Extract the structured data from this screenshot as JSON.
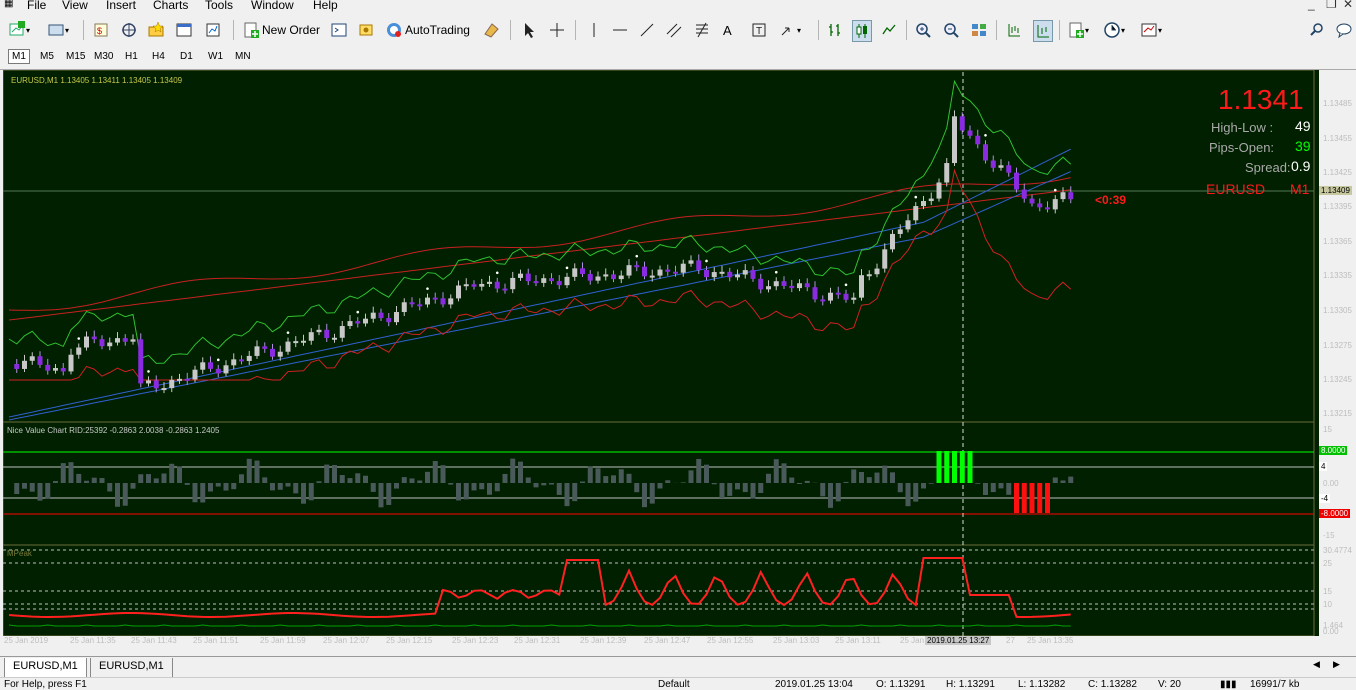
{
  "menu": [
    "File",
    "View",
    "Insert",
    "Charts",
    "Tools",
    "Window",
    "Help"
  ],
  "toolbar": {
    "new_order": "New Order",
    "autotrading": "AutoTrading"
  },
  "timeframes": [
    "M1",
    "M5",
    "M15",
    "M30",
    "H1",
    "H4",
    "D1",
    "W1",
    "MN"
  ],
  "active_timeframe": "M1",
  "chart": {
    "header": "EURUSD,M1  1.13405 1.13411 1.13405 1.13409",
    "bid": "1.1341",
    "high_low_label": "High-Low :",
    "high_low_value": "49",
    "pips_open_label": "Pips-Open:",
    "pips_open_value": "39",
    "spread_label": "Spread:",
    "spread_value": "0.9",
    "symbol": "EURUSD",
    "tf": "M1",
    "countdown": "<0:39",
    "current_price_tag": "1.13409",
    "price_labels": [
      "1.13485",
      "1.13455",
      "1.13425",
      "1.13395",
      "1.13365",
      "1.13335",
      "1.13305",
      "1.13275",
      "1.13245",
      "1.13215"
    ],
    "indicator1_header": "Nice Value Chart RID:25392 -0.2863 2.0038 -0.2863 1.2405",
    "indicator1_levels": [
      "15",
      "8.0000",
      "4",
      "0.00",
      "-4",
      "-8.0000",
      "-15"
    ],
    "indicator2_header": "MPeak",
    "indicator2_levels": [
      "30.4774",
      "25",
      "15",
      "10",
      "1.464",
      "0.00"
    ],
    "time_labels": [
      "25 Jan 2019",
      "25 Jan 11:35",
      "25 Jan 11:43",
      "25 Jan 11:51",
      "25 Jan 11:59",
      "25 Jan 12:07",
      "25 Jan 12:15",
      "25 Jan 12:23",
      "25 Jan 12:31",
      "25 Jan 12:39",
      "25 Jan 12:47",
      "25 Jan 12:55",
      "25 Jan 13:03",
      "25 Jan 13:11",
      "25 Jan",
      "27",
      "25 Jan 13:35"
    ],
    "crosshair_time": "2019.01.25 13:27"
  },
  "tabs": [
    "EURUSD,M1",
    "EURUSD,M1"
  ],
  "status": {
    "help": "For Help, press F1",
    "profile": "Default",
    "datetime": "2019.01.25 13:04",
    "open": "O: 1.13291",
    "high": "H: 1.13291",
    "low": "L: 1.13282",
    "close": "C: 1.13282",
    "volume": "V: 20",
    "traffic": "16991/7 kb"
  },
  "colors": {
    "chart_bg": "#002000",
    "bull": "#c8c8c8",
    "bear": "#8a2be2",
    "bid": "#ff1a1a",
    "green_ind": "#00e600",
    "red_ind": "#ff0000"
  }
}
